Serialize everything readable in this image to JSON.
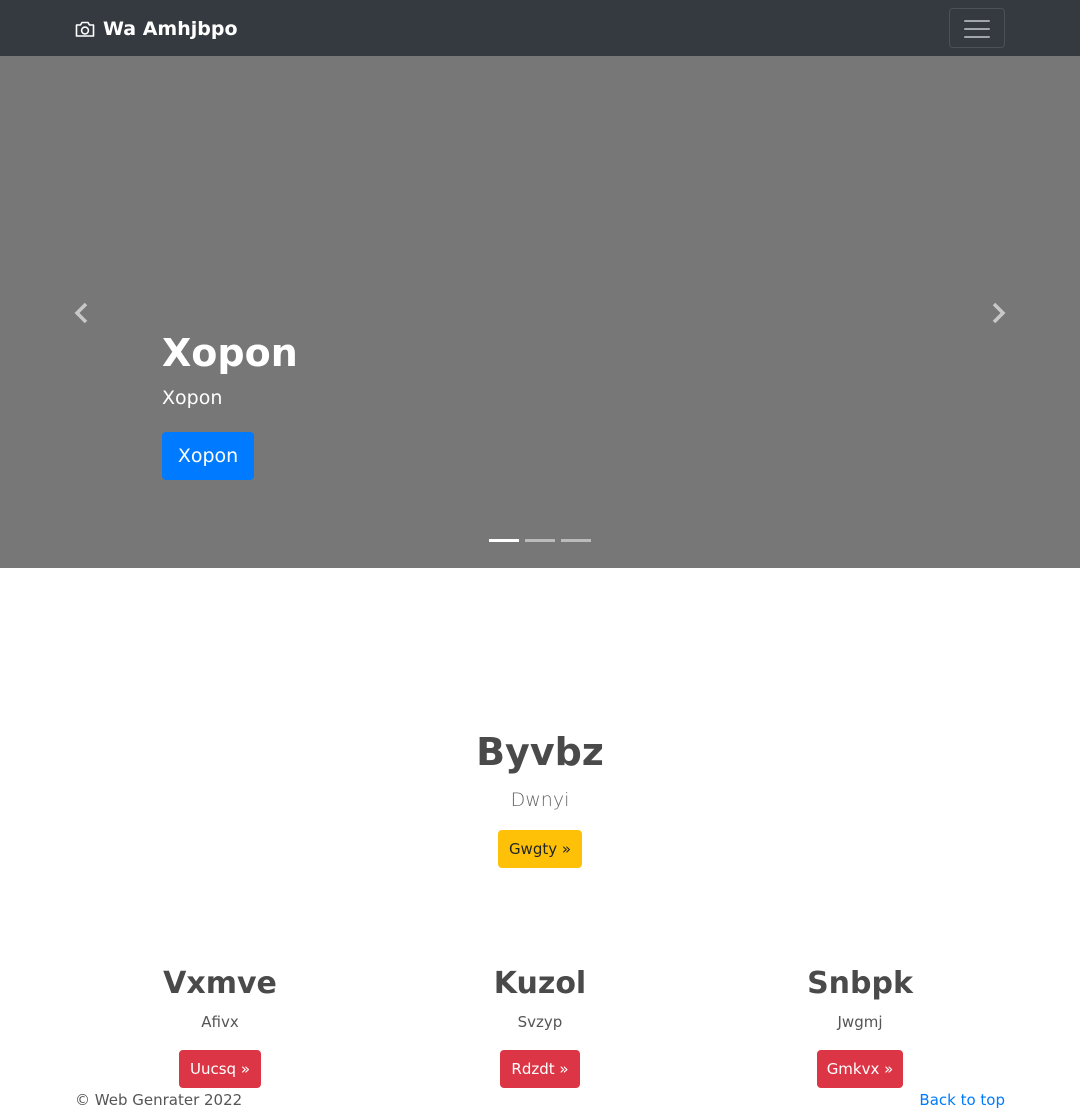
{
  "navbar": {
    "brand": "Wa Amhjbpo",
    "brand_icon": "camera-icon",
    "toggler_icon": "hamburger-icon",
    "background": "#343a40"
  },
  "carousel": {
    "title": "Xopon",
    "subtitle": "Xopon",
    "button_label": "Xopon",
    "prev_icon": "chevron-left-icon",
    "next_icon": "chevron-right-icon",
    "slide_count": 3,
    "active_slide": 1,
    "background": "#777777"
  },
  "feature": {
    "title": "Byvbz",
    "subtitle": "Dwnyi",
    "button_label": "Gwgty »",
    "button_color": "#ffc107"
  },
  "columns": [
    {
      "title": "Vxmve",
      "subtitle": "Afivx",
      "button_label": "Uucsq »"
    },
    {
      "title": "Kuzol",
      "subtitle": "Svzyp",
      "button_label": "Rdzdt »"
    },
    {
      "title": "Snbpk",
      "subtitle": "Jwgmj",
      "button_label": "Gmkvx »"
    }
  ],
  "colors": {
    "primary": "#007bff",
    "danger": "#dc3545"
  },
  "footer": {
    "copyright": "© Web Genrater 2022",
    "back_to_top": "Back to top"
  }
}
